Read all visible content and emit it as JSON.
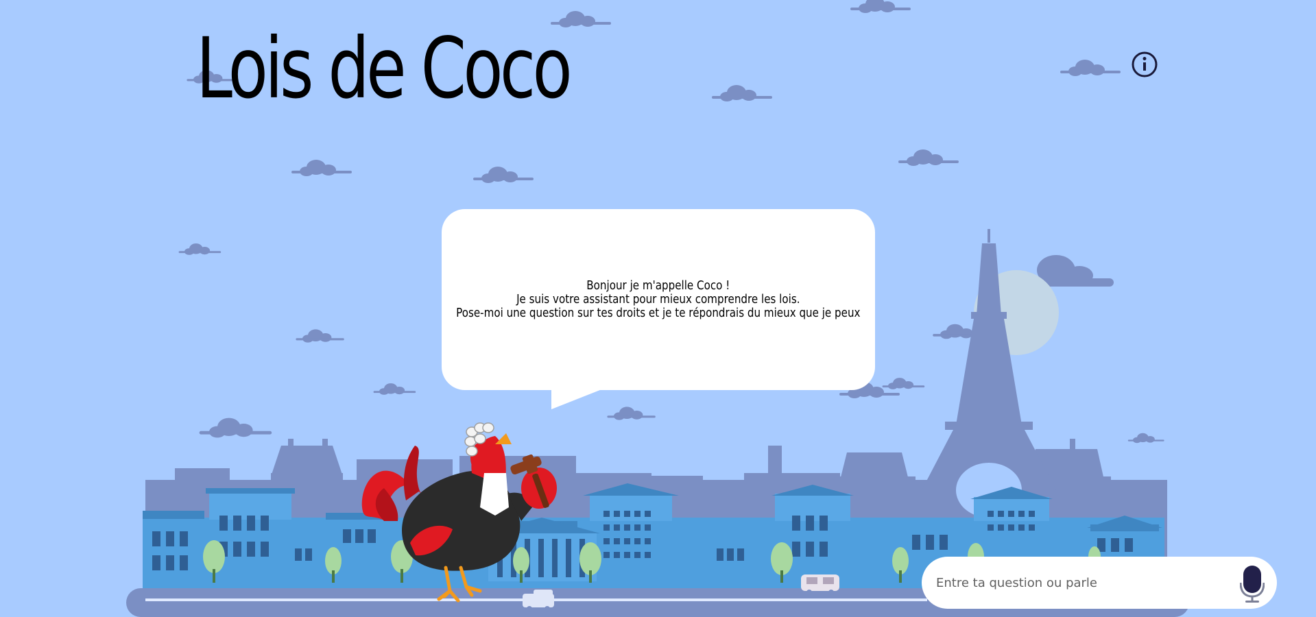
{
  "app": {
    "title": "Lois de Coco"
  },
  "header": {
    "info_icon": "info-circle-icon"
  },
  "speech_bubble": {
    "lines": [
      "Bonjour je m'appelle Coco !",
      "Je suis votre assistant pour mieux comprendre les lois.",
      "Pose-moi une question sur tes droits et je te répondrais du mieux que je peux"
    ]
  },
  "input": {
    "placeholder": "Entre ta question ou parle",
    "value": "",
    "mic_icon": "microphone-icon"
  },
  "colors": {
    "sky": "#a8cbff",
    "buildings": "#7b8fc4",
    "facade": "#4f9fde",
    "rooster_red": "#e01a22",
    "mic": "#22204a"
  }
}
